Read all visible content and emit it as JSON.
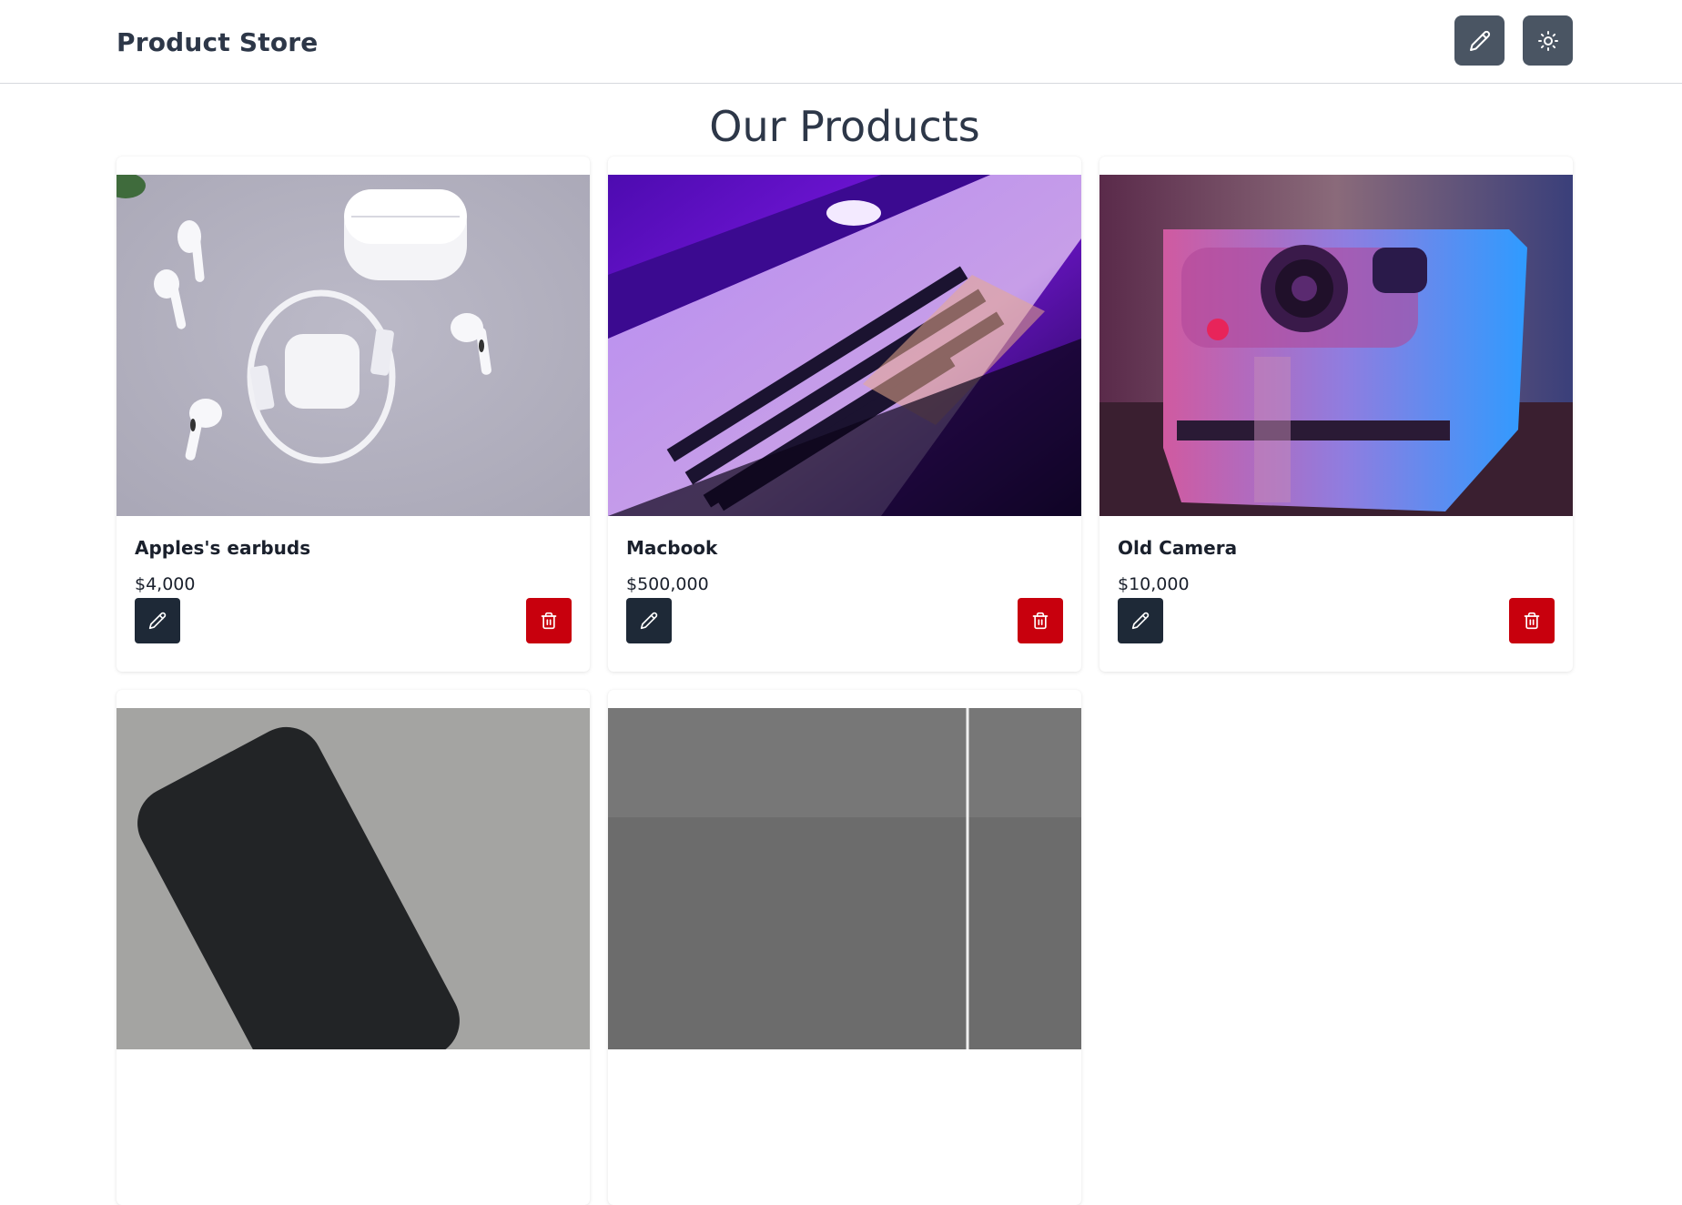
{
  "header": {
    "brand": "Product Store",
    "create_icon": "pencil-icon",
    "theme_icon": "sun-icon"
  },
  "main": {
    "title": "Our Products",
    "products": [
      {
        "name": "Apples's earbuds",
        "price": "$4,000"
      },
      {
        "name": "Macbook",
        "price": "$500,000"
      },
      {
        "name": "Old Camera",
        "price": "$10,000"
      },
      {
        "name": "",
        "price": ""
      },
      {
        "name": "",
        "price": ""
      }
    ]
  },
  "colors": {
    "header_button": "#4a5563",
    "edit_button": "#1e2937",
    "delete_button": "#c8000d",
    "text_heading": "#2d3748"
  }
}
